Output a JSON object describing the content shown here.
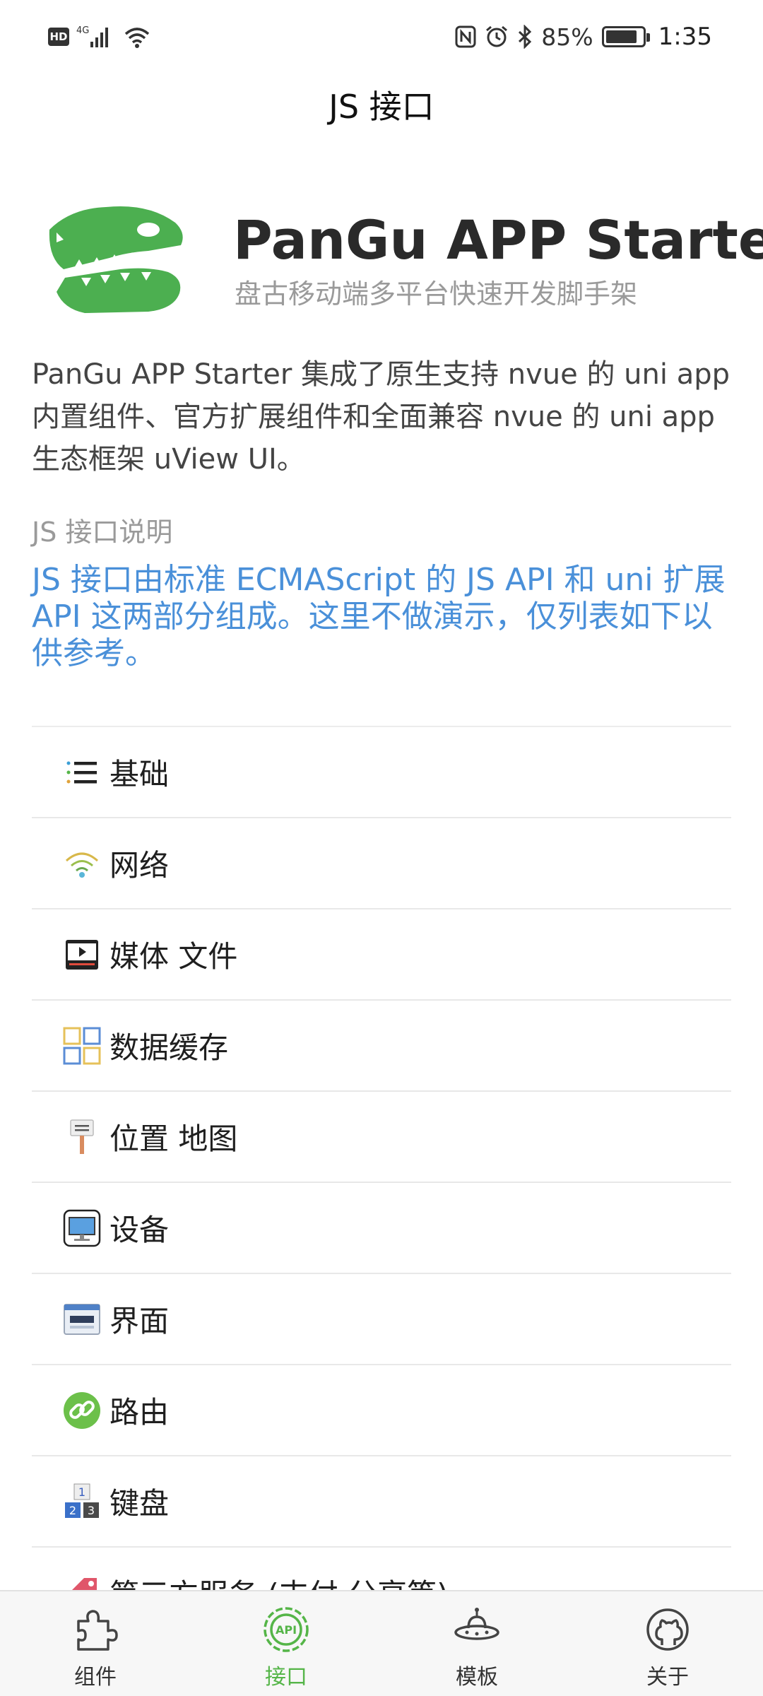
{
  "status_bar": {
    "left_badges": [
      "HD",
      "4G"
    ],
    "battery": "85%",
    "battery_level": 0.85,
    "time": "1:35"
  },
  "header": {
    "title": "JS 接口"
  },
  "hero": {
    "title": "PanGu APP Starter",
    "subtitle": "盘古移动端多平台快速开发脚手架"
  },
  "intro": "PanGu APP Starter 集成了原生支持 nvue 的 uni app 内置组件、官方扩展组件和全面兼容 nvue 的 uni app 生态框架 uView UI。",
  "section": {
    "label": "JS 接口说明",
    "description": "JS 接口由标准 ECMAScript 的 JS API 和 uni 扩展 API 这两部分组成。这里不做演示，仅列表如下以供参考。"
  },
  "list": {
    "items": [
      {
        "label": "基础",
        "icon": "list-icon"
      },
      {
        "label": "网络",
        "icon": "wifi-icon"
      },
      {
        "label": "媒体 文件",
        "icon": "media-player-icon"
      },
      {
        "label": "数据缓存",
        "icon": "grid-icon"
      },
      {
        "label": "位置 地图",
        "icon": "signpost-icon"
      },
      {
        "label": "设备",
        "icon": "monitor-icon"
      },
      {
        "label": "界面",
        "icon": "window-icon"
      },
      {
        "label": "路由",
        "icon": "link-icon"
      },
      {
        "label": "键盘",
        "icon": "number-keys-icon"
      },
      {
        "label": "第三方服务 (支付 分享等)",
        "icon": "tag-icon"
      }
    ]
  },
  "tabs": [
    {
      "label": "组件",
      "icon": "puzzle-icon"
    },
    {
      "label": "接口",
      "icon": "api-gear-icon",
      "active": true
    },
    {
      "label": "模板",
      "icon": "ufo-icon"
    },
    {
      "label": "关于",
      "icon": "github-icon"
    }
  ],
  "colors": {
    "accent": "#55b548",
    "link": "#4a90d9",
    "logo": "#4caf50"
  }
}
